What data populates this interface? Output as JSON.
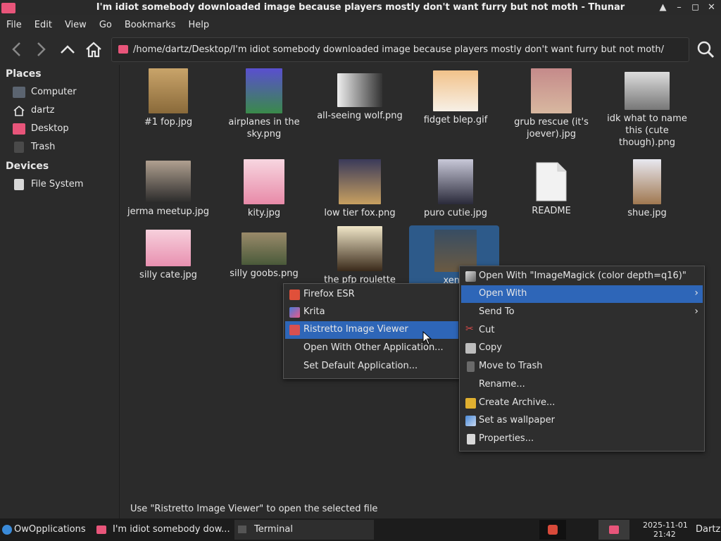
{
  "window": {
    "title": "I'm idiot somebody downloaded image because players mostly don't want furry but not moth - Thunar",
    "buttons": [
      "▲",
      "–",
      "◻",
      "✕"
    ]
  },
  "menubar": [
    "File",
    "Edit",
    "View",
    "Go",
    "Bookmarks",
    "Help"
  ],
  "path": "/home/dartz/Desktop/I'm idiot somebody downloaded image because players mostly don't want furry but not moth/",
  "sidebar": {
    "places_header": "Places",
    "places": [
      {
        "label": "Computer",
        "icon": "computer-icon",
        "color": "#5b6470"
      },
      {
        "label": "dartz",
        "icon": "home-icon",
        "color": "#e6e6e6"
      },
      {
        "label": "Desktop",
        "icon": "desktop-folder-icon",
        "color": "#e8557a"
      },
      {
        "label": "Trash",
        "icon": "trash-icon",
        "color": "#4a4a4a"
      }
    ],
    "devices_header": "Devices",
    "devices": [
      {
        "label": "File System",
        "icon": "drive-icon",
        "color": "#d8d8d8"
      }
    ]
  },
  "files": [
    {
      "name": "#1 fop.jpg"
    },
    {
      "name": "airplanes in the sky.png"
    },
    {
      "name": "all-seeing wolf.png"
    },
    {
      "name": "fidget blep.gif"
    },
    {
      "name": "grub rescue (it's joever).jpg"
    },
    {
      "name": "idk what to name this (cute though).png"
    },
    {
      "name": "jerma meetup.jpg"
    },
    {
      "name": "kity.jpg"
    },
    {
      "name": "low tier fox.png"
    },
    {
      "name": "puro cutie.jpg"
    },
    {
      "name": "README"
    },
    {
      "name": "shue.jpg"
    },
    {
      "name": "silly cate.jpg"
    },
    {
      "name": "silly goobs.png"
    },
    {
      "name": "the pfp roulette"
    },
    {
      "name": "xenia"
    }
  ],
  "context_menu": [
    {
      "label": "Open With \"ImageMagick (color depth=q16)\"",
      "icon": "imagemagick-icon"
    },
    {
      "label": "Open With",
      "submenu": true,
      "highlighted": true
    },
    {
      "label": "Send To",
      "submenu": true
    },
    {
      "label": "Cut",
      "icon": "cut-icon"
    },
    {
      "label": "Copy",
      "icon": "copy-icon"
    },
    {
      "label": "Move to Trash",
      "icon": "trash-icon"
    },
    {
      "label": "Rename..."
    },
    {
      "label": "Create Archive...",
      "icon": "archive-icon"
    },
    {
      "label": "Set as wallpaper",
      "icon": "wallpaper-icon"
    },
    {
      "label": "Properties...",
      "icon": "properties-icon"
    }
  ],
  "open_with_submenu": [
    {
      "label": "Firefox ESR",
      "icon": "firefox-icon"
    },
    {
      "label": "Krita",
      "icon": "krita-icon"
    },
    {
      "label": "Ristretto Image Viewer",
      "icon": "ristretto-icon",
      "highlighted": true
    },
    {
      "label": "Open With Other Application..."
    },
    {
      "label": "Set Default Application..."
    }
  ],
  "statusbar": "Use \"Ristretto Image Viewer\" to open the selected file",
  "taskbar": {
    "start": "OwOpplications",
    "tasks": [
      "I'm idiot somebody dow...",
      "Terminal"
    ],
    "date": "2025-11-01",
    "time": "21:42",
    "user": "Dartz"
  },
  "colors": {
    "accent": "#2e66b8",
    "selection": "#2d5a8a",
    "folder": "#e8557a"
  }
}
